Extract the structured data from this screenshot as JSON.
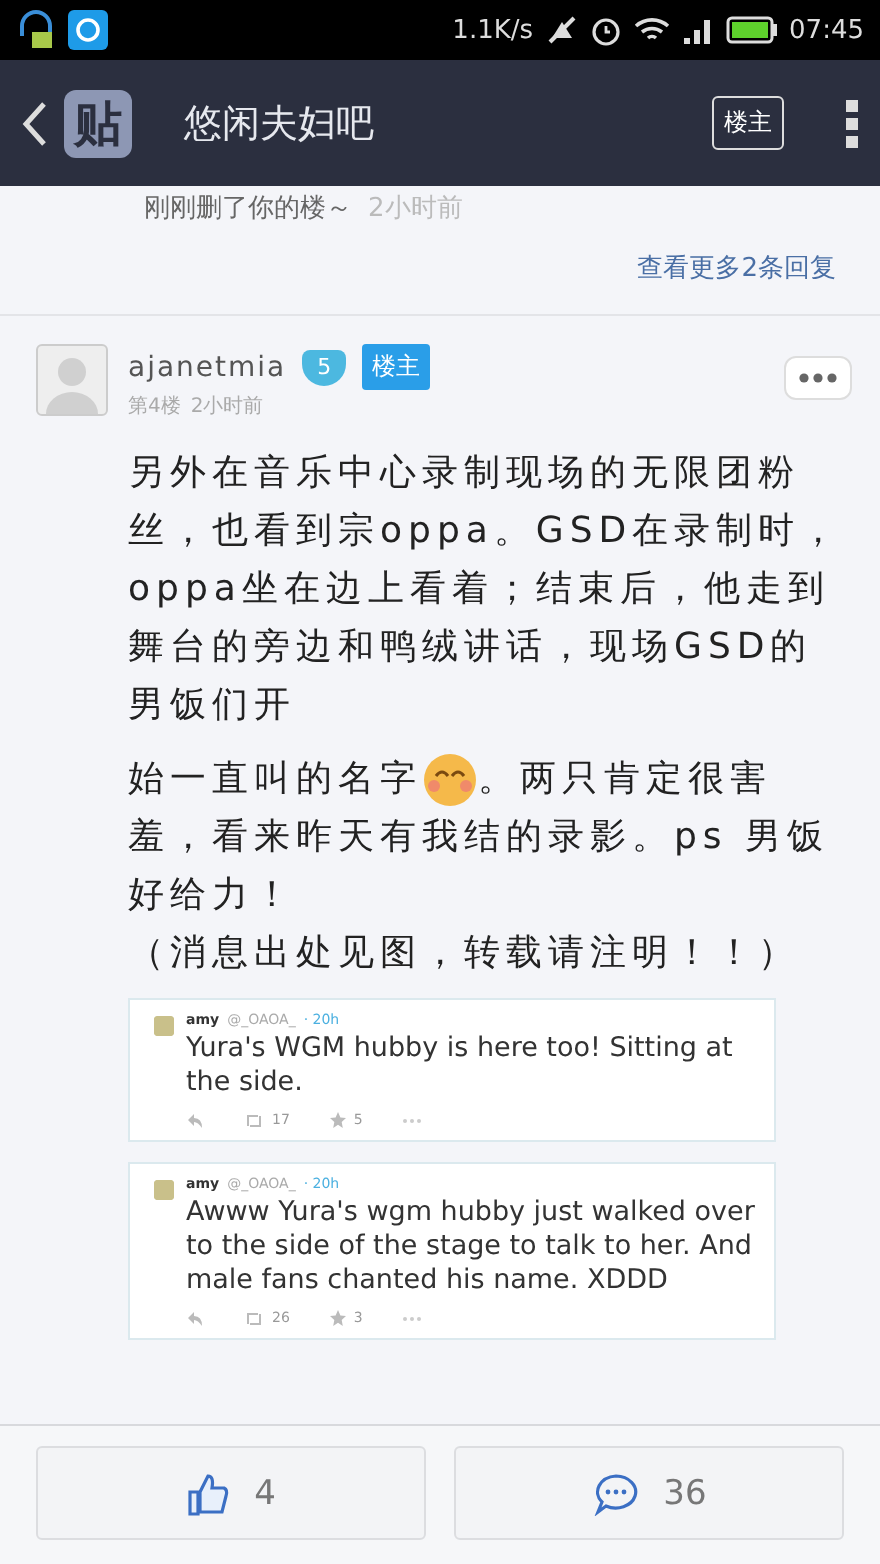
{
  "status_bar": {
    "speed": "1.1K/s",
    "time": "07:45"
  },
  "header": {
    "logo": "贴",
    "title": "悠闲夫妇吧",
    "owner_button": "楼主"
  },
  "previous_reply": {
    "text": "刚刚删了你的楼～",
    "time": "2小时前"
  },
  "more_replies": "查看更多2条回复",
  "post": {
    "username": "ajanetmia",
    "level": "5",
    "badge": "楼主",
    "floor": "第4楼",
    "time": "2小时前",
    "paragraphs": [
      "另外在音乐中心录制现场的无限团粉丝，也看到宗oppa。GSD在录制时，oppa坐在边上看着；结束后，他走到舞台的旁边和鸭绒讲话，现场GSD的男饭们开",
      "始一直叫的名字",
      "。两只肯定很害",
      "羞，看来昨天有我结的录影。ps 男饭好给力！",
      "（消息出处见图，转载请注明！！）"
    ]
  },
  "tweets": [
    {
      "name": "amy",
      "handle": "@_OAOA_",
      "time": "· 20h",
      "text": "Yura's WGM hubby is here too! Sitting at the side.",
      "retweets": "17",
      "favorites": "5"
    },
    {
      "name": "amy",
      "handle": "@_OAOA_",
      "time": "· 20h",
      "text": "Awww Yura's wgm hubby just walked over to the side of the stage to talk to her. And male fans chanted his name. XDDD",
      "retweets": "26",
      "favorites": "3"
    }
  ],
  "footer": {
    "likes": "4",
    "comments": "36"
  }
}
